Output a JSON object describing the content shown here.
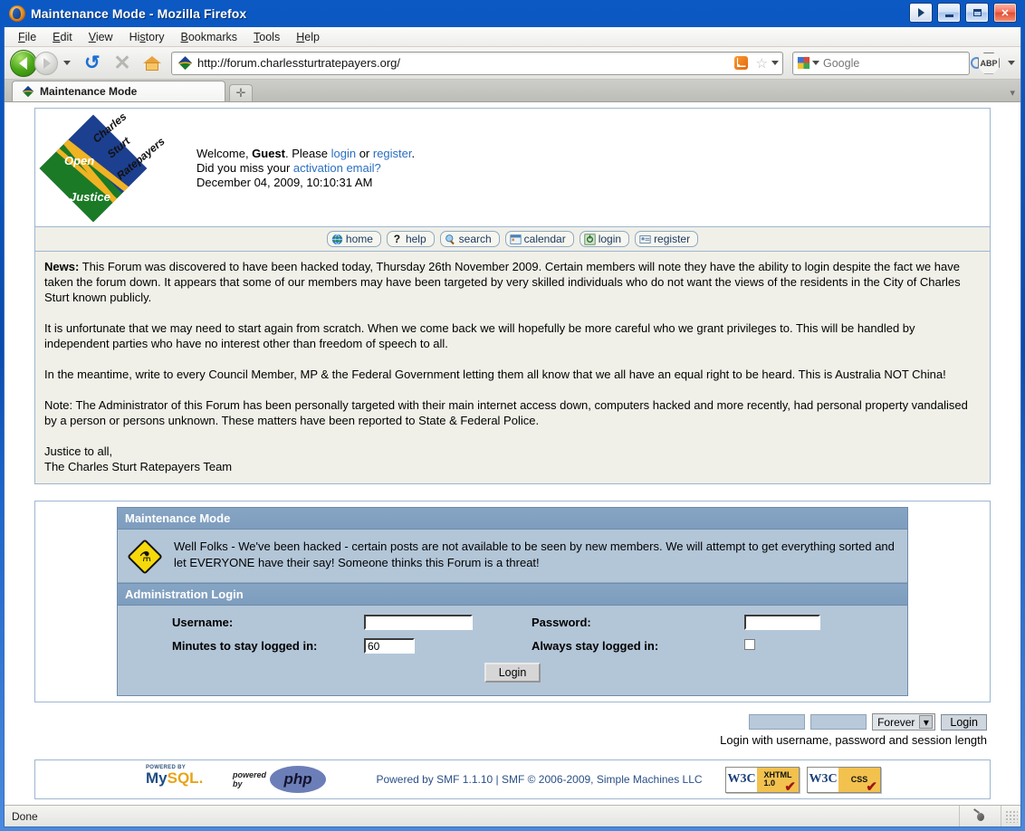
{
  "window": {
    "title": "Maintenance Mode - Mozilla Firefox",
    "icon": "firefox-icon",
    "buttons": {
      "overflow": "▶",
      "minimize": "minimize",
      "maximize": "maximize",
      "close": "✕"
    }
  },
  "menubar": {
    "items": [
      {
        "label": "File"
      },
      {
        "label": "Edit"
      },
      {
        "label": "View"
      },
      {
        "label": "History"
      },
      {
        "label": "Bookmarks"
      },
      {
        "label": "Tools"
      },
      {
        "label": "Help"
      }
    ]
  },
  "toolbar": {
    "back": "back-button",
    "forward": "forward-button",
    "dropdown": "recent-pages-dropdown",
    "reload": "reload-button",
    "stop": "stop-button",
    "home": "home-button",
    "url": "http://forum.charlessturtratepayers.org/",
    "rss": "rss-feed-icon",
    "bookmark_star": "☆",
    "search_placeholder": "Google",
    "search_value": "",
    "search_engine": "Google",
    "adblock_label": "ABP"
  },
  "tabs": {
    "items": [
      {
        "label": "Maintenance Mode",
        "active": true
      }
    ],
    "new_tab_label": "+"
  },
  "forum": {
    "logo": {
      "word_open": "Open",
      "word_justice": "Justice",
      "arc_1": "Charles",
      "arc_2": "Sturt",
      "arc_3": "Ratepayers"
    },
    "welcome": {
      "line1_pre": "Welcome, ",
      "line1_user": "Guest",
      "line1_mid": ". Please ",
      "login": "login",
      "line1_or": " or ",
      "register": "register",
      "line1_end": ".",
      "line2_pre": "Did you miss your ",
      "activation": "activation email?",
      "datetime": "December 04, 2009, 10:10:31 AM"
    },
    "nav": [
      {
        "label": "home",
        "icon": "globe-icon"
      },
      {
        "label": "help",
        "icon": "question-mark-icon"
      },
      {
        "label": "search",
        "icon": "magnifier-icon"
      },
      {
        "label": "calendar",
        "icon": "calendar-icon"
      },
      {
        "label": "login",
        "icon": "key-icon"
      },
      {
        "label": "register",
        "icon": "id-card-icon"
      }
    ],
    "news": {
      "label": "News:",
      "paragraphs": [
        "This Forum was discovered to have been hacked today, Thursday 26th November 2009.  Certain members will note they have the ability to login despite the fact we have taken the forum down. It appears that some of our members may have been targeted by very skilled individuals who do not want the views of the residents in the City of Charles Sturt known publicly.",
        "It is unfortunate that we may need to start again from scratch. When we come back we will hopefully be more careful who we grant privileges to.  This will be handled by independent parties who have no interest other than freedom of speech to all.",
        "In the meantime, write to every Council Member, MP & the Federal Government letting them all know that we all have an equal right to be heard. This is Australia NOT China!",
        "Note: The Administrator of this Forum has been personally targeted with their main internet access down, computers hacked and more recently, had personal property vandalised by a person or persons unknown.  These matters have been reported to State & Federal Police."
      ],
      "sign_off_1": "Justice to all,",
      "sign_off_2": "The Charles Sturt Ratepayers Team"
    },
    "maintenance": {
      "title": "Maintenance Mode",
      "icon": "warning-sign-icon",
      "message": "Well Folks - We've been hacked - certain posts are not available to be seen by new members. We will attempt to get everything sorted and let EVERYONE have their say! Someone thinks this Forum is a threat!"
    },
    "admin_login": {
      "title": "Administration Login",
      "username_label": "Username:",
      "username_value": "",
      "password_label": "Password:",
      "password_value": "",
      "minutes_label": "Minutes to stay logged in:",
      "minutes_value": "60",
      "always_label": "Always stay logged in:",
      "always_checked": false,
      "submit_label": "Login"
    },
    "quick_login": {
      "username_value": "",
      "password_value": "",
      "session_length": "Forever",
      "session_options": [
        "Forever"
      ],
      "submit_label": "Login",
      "caption": "Login with username, password and session length"
    },
    "footer": {
      "mysql_top": "POWERED BY",
      "mysql_my": "My",
      "mysql_sql": "SQL.",
      "php_powered": "powered",
      "php_by": "by",
      "php_word": "php",
      "credit": "Powered by SMF 1.1.10 | SMF © 2006-2009, Simple Machines LLC",
      "badges": [
        {
          "left": "W3C",
          "right_line1": "XHTML",
          "right_line2": "1.0"
        },
        {
          "left": "W3C",
          "right_line1": "CSS",
          "right_line2": ""
        }
      ]
    }
  },
  "statusbar": {
    "text": "Done",
    "bug_icon": "bug-icon",
    "resize_grip": "resize-grip"
  },
  "colors": {
    "title_blue": "#0a4bad",
    "forum_border": "#9eb6d0",
    "cat_bar": "#7e9dbe",
    "panel_body": "#b3c6d8",
    "news_bg": "#f0f0e8",
    "link": "#2a6ec0"
  }
}
